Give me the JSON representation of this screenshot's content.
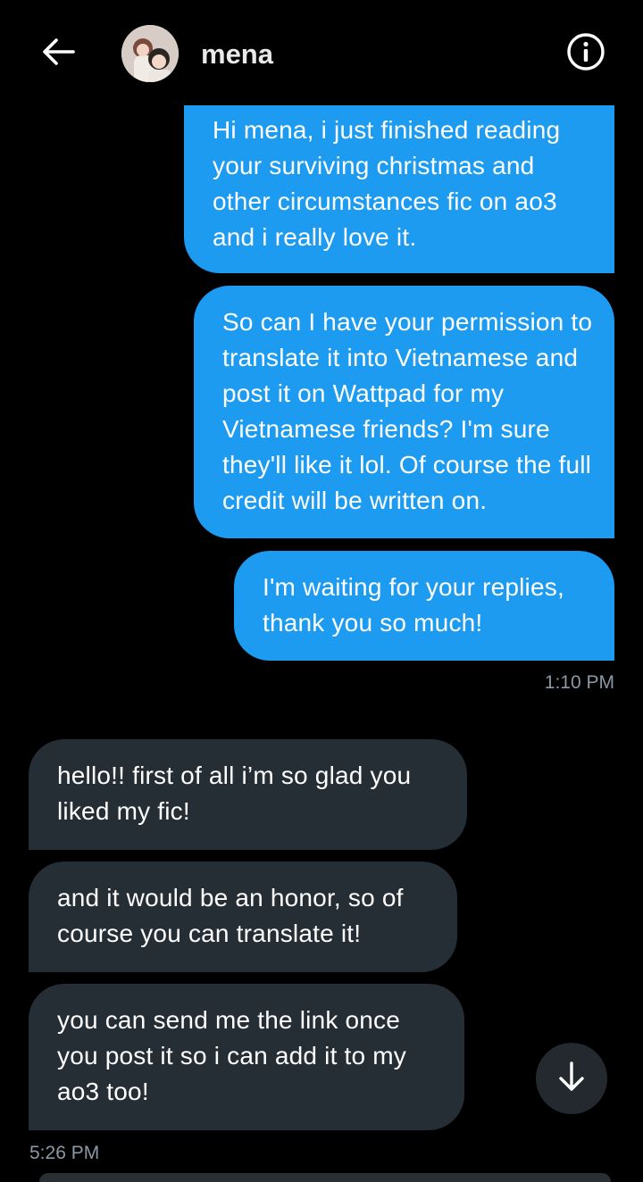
{
  "header": {
    "contact_name": "mena",
    "back_icon": "arrow-left-icon",
    "info_icon": "info-circle-icon"
  },
  "messages": [
    {
      "direction": "sent",
      "text": "Hi mena, i just finished reading your surviving christmas and other circumstances fic on ao3 and i really love it."
    },
    {
      "direction": "sent",
      "text": "So can I have your permission to translate it into Vietnamese and post it on Wattpad for my Vietnamese friends? I'm sure they'll like it lol. Of course the full credit will be written on."
    },
    {
      "direction": "sent",
      "text": "I'm waiting for your replies, thank you so much!"
    },
    {
      "direction": "received",
      "text": "hello!! first of all i’m so glad you liked my fic!"
    },
    {
      "direction": "received",
      "text": "and it would be an honor, so of course you can translate it!"
    },
    {
      "direction": "received",
      "text": "you can send me the link once you post it so i can add it to my ao3 too!"
    }
  ],
  "timestamps": {
    "sent_group": "1:10 PM",
    "received_group": "5:26 PM"
  },
  "scroll_button_icon": "arrow-down-icon",
  "colors": {
    "background": "#000000",
    "sent_bubble": "#1d9bf0",
    "received_bubble": "#252d35",
    "timestamp": "#8b98a5"
  }
}
